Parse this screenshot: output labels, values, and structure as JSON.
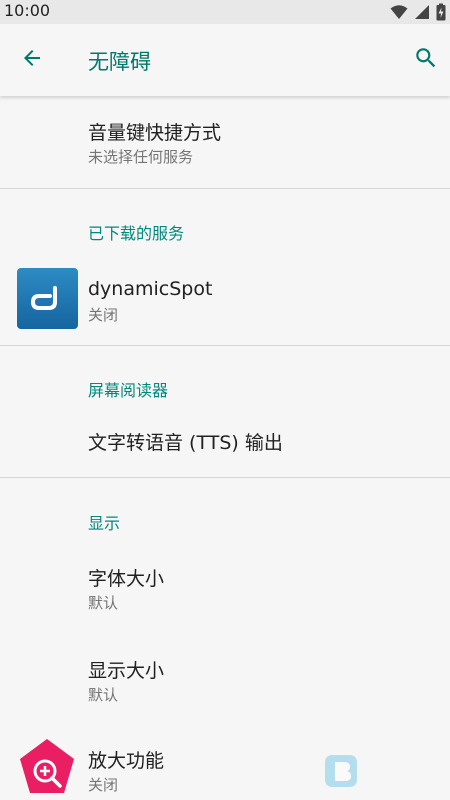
{
  "status_bar": {
    "time": "10:00"
  },
  "app_bar": {
    "title": "无障碍"
  },
  "items": {
    "volume_shortcut": {
      "title": "音量键快捷方式",
      "subtitle": "未选择任何服务"
    },
    "downloaded_header": "已下载的服务",
    "dynamicspot": {
      "title": "dynamicSpot",
      "subtitle": "关闭"
    },
    "screen_reader_header": "屏幕阅读器",
    "tts": {
      "title": "文字转语音 (TTS) 输出"
    },
    "display_header": "显示",
    "font_size": {
      "title": "字体大小",
      "subtitle": "默认"
    },
    "display_size": {
      "title": "显示大小",
      "subtitle": "默认"
    },
    "magnification": {
      "title": "放大功能",
      "subtitle": "关闭"
    }
  },
  "colors": {
    "accent": "#00796b",
    "header": "#00897b",
    "magnify_icon": "#e91e63"
  }
}
